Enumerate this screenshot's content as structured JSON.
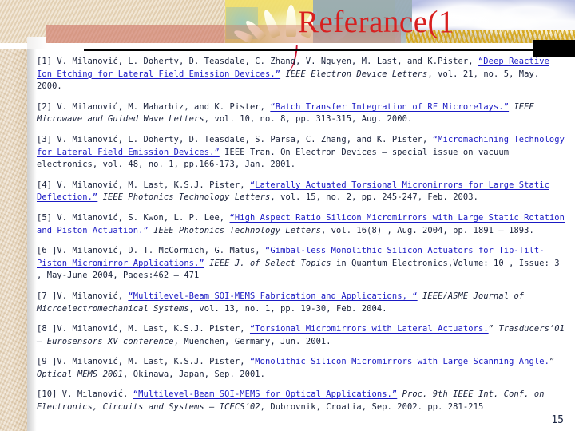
{
  "slide": {
    "title": "Referance(1",
    "page_number": "15",
    "title_color": "#d81f1f",
    "link_color": "#1a1ac4",
    "text_color": "#18203a"
  },
  "references": [
    {
      "id": "ref-1",
      "parts": [
        {
          "style": "plain",
          "text": "[1] V. Milanović, L. Doherty, D. Teasdale, C. Zhang, V. Nguyen, M. Last, and K.Pister, "
        },
        {
          "style": "link",
          "text": "“Deep Reactive Ion Etching for Lateral Field Emission Devices.”"
        },
        {
          "style": "plain",
          "text": " "
        },
        {
          "style": "italic",
          "text": "IEEE  Electron Device Letters"
        },
        {
          "style": "plain",
          "text": ", vol. 21, no. 5, May. 2000."
        }
      ]
    },
    {
      "id": "ref-2",
      "parts": [
        {
          "style": "plain",
          "text": "[2] V. Milanović, M. Maharbiz, and K. Pister, "
        },
        {
          "style": "link",
          "text": "“Batch Transfer Integration of RF Microrelays.”"
        },
        {
          "style": "plain",
          "text": " "
        },
        {
          "style": "italic",
          "text": "IEEE Microwave and Guided Wave Letters"
        },
        {
          "style": "plain",
          "text": ", vol. 10, no. 8, pp. 313-315, Aug. 2000."
        }
      ]
    },
    {
      "id": "ref-3",
      "parts": [
        {
          "style": "plain",
          "text": "[3] V. Milanović, L. Doherty, D. Teasdale, S. Parsa, C. Zhang, and K. Pister, "
        },
        {
          "style": "link",
          "text": "“Micromachining Technology for Lateral Field Emission Devices.”"
        },
        {
          "style": "plain",
          "text": " IEEE Tran. On Electron Devices – special issue on vacuum electronics, vol. 48, no. 1, pp.166-173, Jan. 2001."
        }
      ]
    },
    {
      "id": "ref-4",
      "parts": [
        {
          "style": "plain",
          "text": "[4] V. Milanović, M. Last, K.S.J. Pister, "
        },
        {
          "style": "link",
          "text": "“Laterally Actuated Torsional Micromirrors for Large Static Deflection.”"
        },
        {
          "style": "plain",
          "text": " "
        },
        {
          "style": "italic",
          "text": "IEEE Photonics Technology Letters"
        },
        {
          "style": "plain",
          "text": ", vol. 15, no. 2, pp. 245-247, Feb. 2003."
        }
      ]
    },
    {
      "id": "ref-5",
      "parts": [
        {
          "style": "plain",
          "text": "[5] V. Milanović, S. Kwon, L. P. Lee, "
        },
        {
          "style": "link",
          "text": "“High Aspect Ratio Silicon Micromirrors with Large Static Rotation and Piston Actuation.”"
        },
        {
          "style": "plain",
          "text": " "
        },
        {
          "style": "italic",
          "text": "IEEE Photonics Technology Letters"
        },
        {
          "style": "plain",
          "text": ", vol. 16(8) , Aug. 2004, pp. 1891 – 1893."
        }
      ]
    },
    {
      "id": "ref-6",
      "parts": [
        {
          "style": "plain",
          "text": "[6 ]V. Milanović, D. T. McCormich, G. Matus, "
        },
        {
          "style": "link",
          "text": "“Gimbal-less Monolithic Silicon Actuators for Tip-Tilt-Piston Micromirror Applications.”"
        },
        {
          "style": "plain",
          "text": " "
        },
        {
          "style": "italic",
          "text": "IEEE J. of Select Topics"
        },
        {
          "style": "plain",
          "text": " in Quantum Electronics,Volume: 10 , Issue: 3 , May-June 2004, Pages:462 – 471"
        }
      ]
    },
    {
      "id": "ref-7",
      "parts": [
        {
          "style": "plain",
          "text": "[7 ]V. Milanović, "
        },
        {
          "style": "link",
          "text": "“Multilevel-Beam SOI-MEMS Fabrication and Applications, “"
        },
        {
          "style": "plain",
          "text": " "
        },
        {
          "style": "italic",
          "text": "IEEE/ASME Journal of Microelectromechanical Systems"
        },
        {
          "style": "plain",
          "text": ", vol. 13, no. 1, pp. 19-30, Feb. 2004."
        }
      ]
    },
    {
      "id": "ref-8",
      "parts": [
        {
          "style": "plain",
          "text": "[8 ]V. Milanović, M. Last, K.S.J. Pister, "
        },
        {
          "style": "link",
          "text": "“Torsional Micromirrors with Lateral Actuators."
        },
        {
          "style": "plain",
          "text": "”  "
        },
        {
          "style": "italic",
          "text": "Trasducers’01 – Eurosensors XV conference"
        },
        {
          "style": "plain",
          "text": ", Muenchen, Germany, Jun. 2001."
        }
      ]
    },
    {
      "id": "ref-9",
      "parts": [
        {
          "style": "plain",
          "text": "[9 ]V. Milanović, M. Last, K.S.J. Pister, "
        },
        {
          "style": "link",
          "text": "“Monolithic Silicon Micromirrors with Large Scanning Angle."
        },
        {
          "style": "plain",
          "text": "” "
        },
        {
          "style": "italic",
          "text": "Optical MEMS 2001"
        },
        {
          "style": "plain",
          "text": ", Okinawa, Japan, Sep. 2001."
        }
      ]
    },
    {
      "id": "ref-10",
      "parts": [
        {
          "style": "plain",
          "text": "[10] V. Milanović, "
        },
        {
          "style": "link",
          "text": "“Multilevel-Beam SOI-MEMS for Optical Applications.”"
        },
        {
          "style": "plain",
          "text": " "
        },
        {
          "style": "italic",
          "text": "Proc. 9th IEEE Int. Conf. on Electronics, Circuits and Systems – ICECS’02"
        },
        {
          "style": "plain",
          "text": ", Dubrovnik, Croatia, Sep. 2002. pp. 281-215"
        }
      ]
    }
  ]
}
